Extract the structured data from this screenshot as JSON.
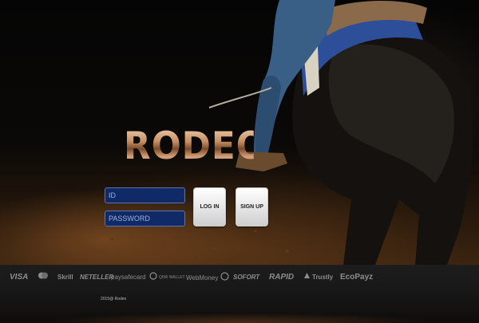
{
  "brand": {
    "logo_text": "RODEO"
  },
  "login_form": {
    "id_placeholder": "ID",
    "password_placeholder": "PASSWORD",
    "login_label": "LOG IN",
    "signup_label": "SIGN UP"
  },
  "footer": {
    "payment_methods": [
      {
        "label": "VISA",
        "icon": "visa-icon"
      },
      {
        "label": "",
        "icon": "mastercard-icon"
      },
      {
        "label": "Skrill",
        "icon": "skrill-icon"
      },
      {
        "label": "NETELLER",
        "icon": "neteller-icon"
      },
      {
        "label": "paysafecard",
        "icon": "paysafecard-icon"
      },
      {
        "label": "QIWI WALLET",
        "icon": "qiwi-icon"
      },
      {
        "label": "WebMoney",
        "icon": "webmoney-icon"
      },
      {
        "label": "SOFORT",
        "icon": "sofort-icon"
      },
      {
        "label": "RAPID",
        "icon": "rapid-icon"
      },
      {
        "label": "Trustly",
        "icon": "trustly-icon"
      },
      {
        "label": "EcoPayz",
        "icon": "ecopayz-icon"
      }
    ],
    "copyright": "2015@ Rodeo"
  }
}
